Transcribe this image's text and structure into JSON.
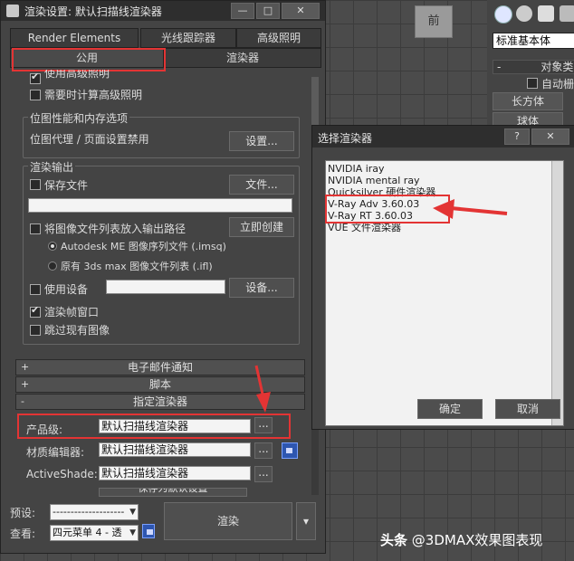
{
  "viewport": {
    "nav_cube_label": "前"
  },
  "command_panel": {
    "dropdown_value": "标准基本体",
    "section_label": "对象类",
    "auto_grid_label": "自动栅",
    "box_button": "长方体",
    "sphere_button": "球体"
  },
  "render_dialog": {
    "title": "渲染设置: 默认扫描线渲染器",
    "tabs": {
      "render_elements": "Render Elements",
      "raytracer": "光线跟踪器",
      "advanced_lighting": "高级照明",
      "common": "公用",
      "renderer": "渲染器"
    },
    "adv_lighting_use": "使用高级照明",
    "adv_lighting_compute": "需要时计算高级照明",
    "bitmap_group": {
      "title": "位图性能和内存选项",
      "text": "位图代理 / 页面设置禁用",
      "setup_button": "设置..."
    },
    "output_group": {
      "title": "渲染输出",
      "save_file": "保存文件",
      "file_button": "文件...",
      "file_path": "",
      "put_list": "将图像文件列表放入输出路径",
      "create_now_button": "立即创建",
      "radio_imsq": "Autodesk ME 图像序列文件 (.imsq)",
      "radio_ifl": "原有 3ds max 图像文件列表 (.ifl)",
      "use_device": "使用设备",
      "device_button": "设备...",
      "device_value": "",
      "render_frame_window": "渲染帧窗口",
      "skip_existing": "跳过现有图像"
    },
    "rollouts": {
      "email": "电子邮件通知",
      "script": "脚本",
      "assign": "指定渲染器"
    },
    "assign": {
      "production_label": "产品级:",
      "production_value": "默认扫描线渲染器",
      "material_label": "材质编辑器:",
      "material_value": "默认扫描线渲染器",
      "activeshade_label": "ActiveShade:",
      "activeshade_value": "默认扫描线渲染器",
      "browse_button": "...",
      "save_default_button": "保存为默认设置"
    },
    "bottom": {
      "preset_label": "预设:",
      "preset_value": "--------------------",
      "view_label": "查看:",
      "view_value": "四元菜单 4 - 透",
      "render_button": "渲染"
    }
  },
  "chooser_dialog": {
    "title": "选择渲染器",
    "help_button": "?",
    "close_button": "✕",
    "items": [
      "NVIDIA iray",
      "NVIDIA mental ray",
      "Quicksilver 硬件渲染器",
      "V-Ray Adv 3.60.03",
      "V-Ray RT 3.60.03",
      "VUE 文件渲染器"
    ],
    "ok_button": "确定",
    "cancel_button": "取消"
  },
  "watermark": {
    "brand": "头条",
    "text": "@3DMAX效果图表现"
  },
  "colors": {
    "highlight_red": "#e33434",
    "dialog_bg": "#444444",
    "field_bg": "#f4f4f4"
  }
}
